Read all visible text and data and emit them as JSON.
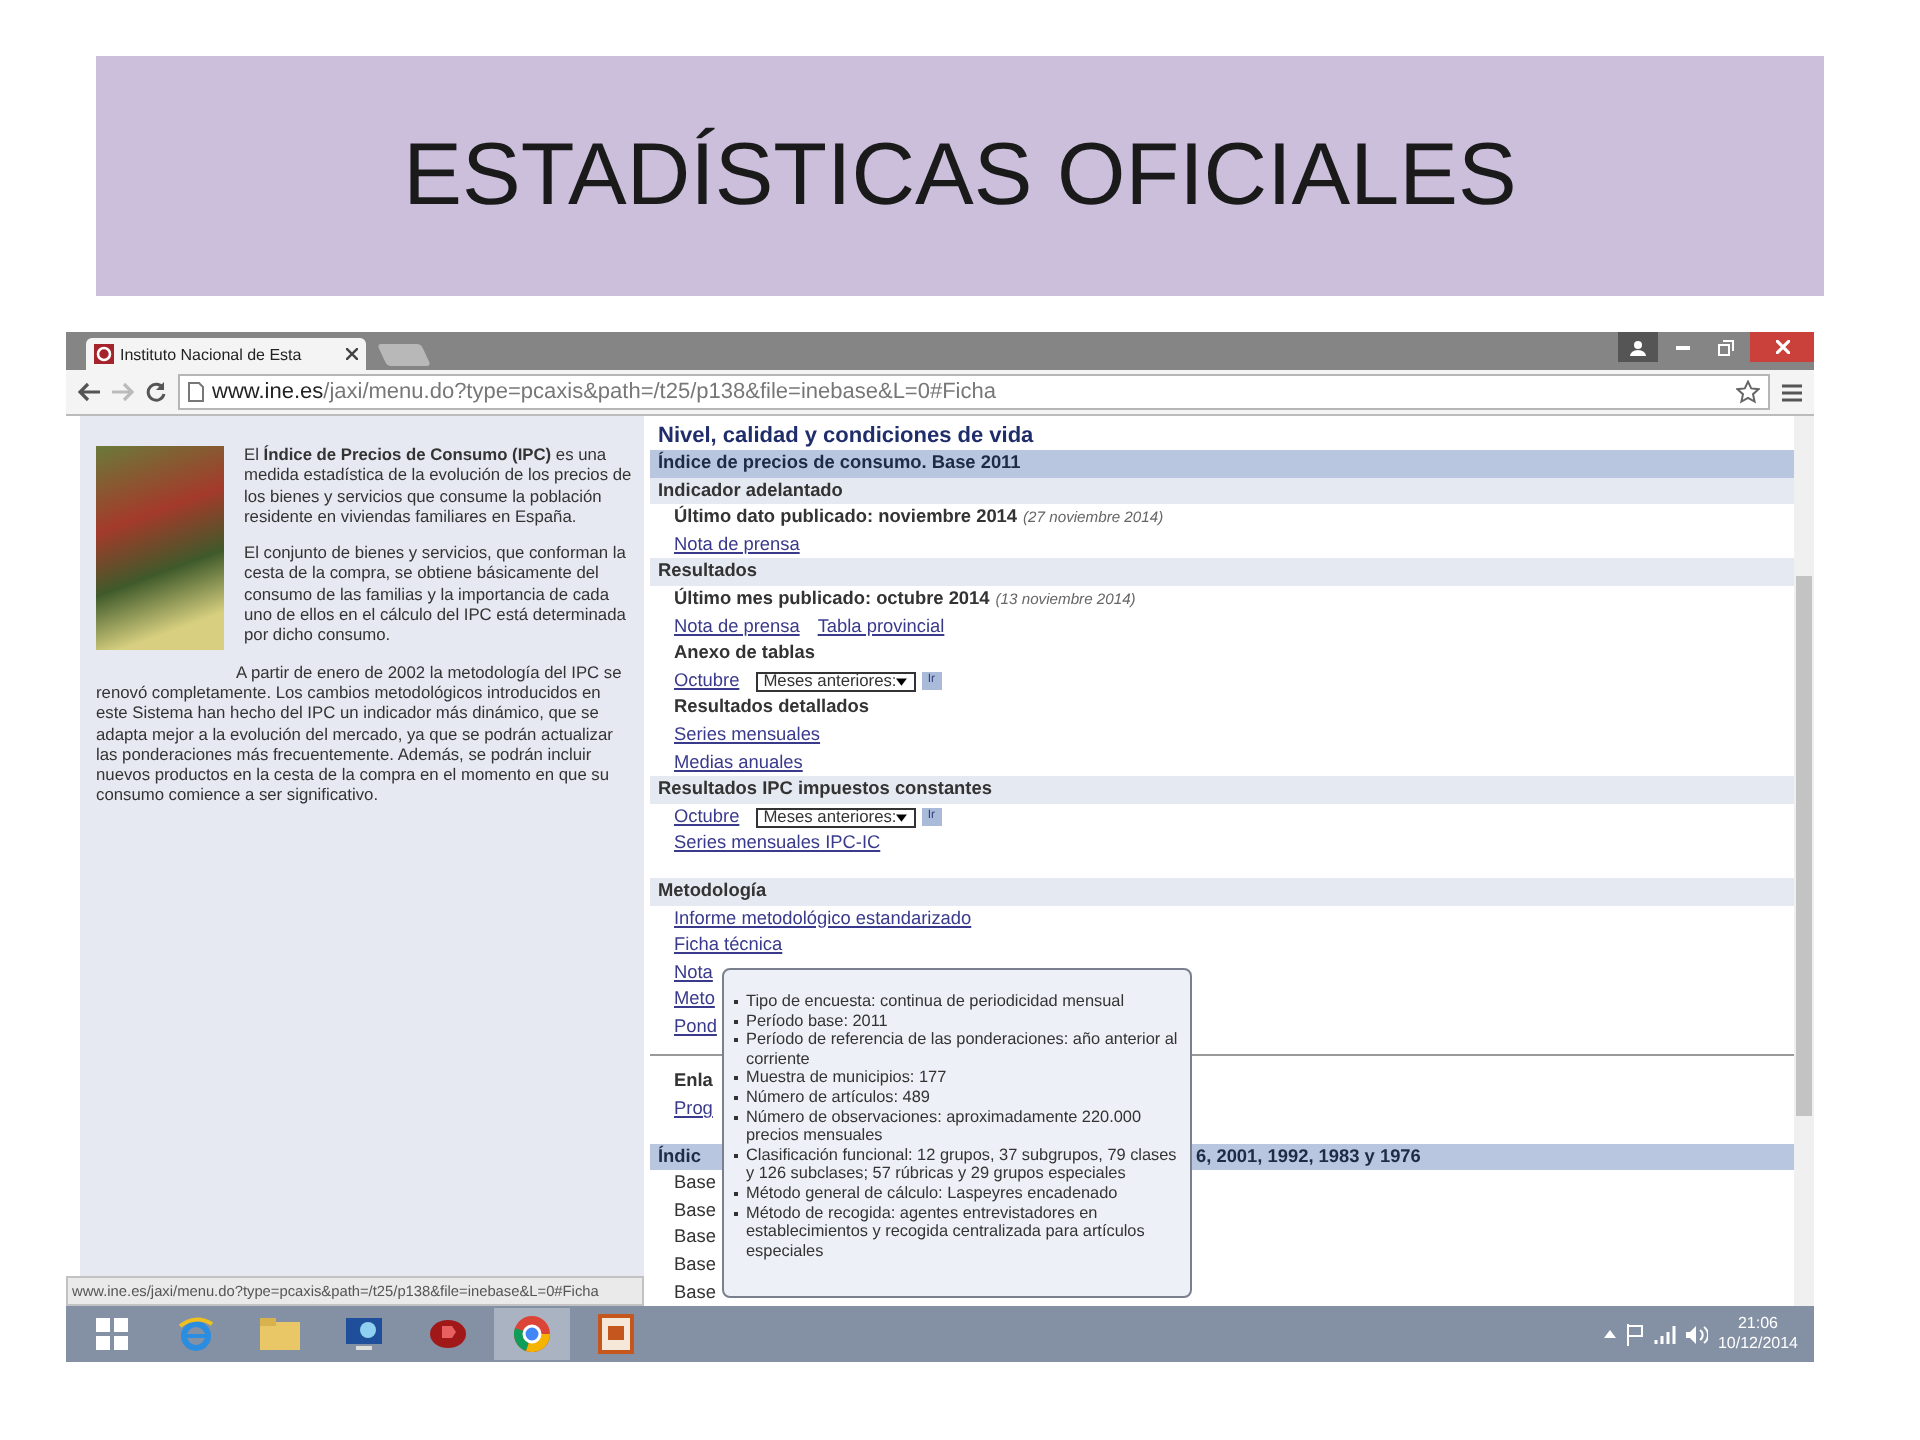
{
  "slide": {
    "title": "ESTADÍSTICAS OFICIALES"
  },
  "browser": {
    "tab": {
      "title": "Instituto Nacional de Esta",
      "selected": true
    },
    "address": {
      "domain": "www.ine.es",
      "path": "/jaxi/menu.do?type=pcaxis&path=/t25/p138&file=inebase&L=0#Ficha"
    },
    "status_url": "www.ine.es/jaxi/menu.do?type=pcaxis&path=/t25/p138&file=inebase&L=0#Ficha"
  },
  "intro": {
    "paragraphs": [
      "El **Índice de Precios de Consumo (IPC)** es una medida estadística de la evolución de los precios de los bienes y servicios que consume la población residente en viviendas familiares en España.",
      "El conjunto de bienes y servicios, que conforman la cesta de la compra, se obtiene básicamente del consumo de las familias y la importancia de cada uno de ellos en el cálculo del IPC está determinada por dicho consumo.",
      "A partir de enero de 2002 la metodología del IPC se renovó completamente. Los cambios metodológicos introducidos en este Sistema han hecho del IPC un indicador más dinámico, que se adapta mejor a la evolución del mercado, ya que se podrán actualizar las ponderaciones más frecuentemente. Además, se podrán incluir nuevos productos en la cesta de la compra en el momento en que su consumo comience a ser significativo."
    ]
  },
  "content": {
    "title": "Nivel, calidad y condiciones de vida",
    "rows": [
      {
        "kind": "header",
        "text": "Índice de precios de consumo. Base 2011"
      },
      {
        "kind": "section",
        "text": "Indicador adelantado"
      },
      {
        "kind": "info",
        "text": "Último dato publicado: noviembre 2014",
        "date": "(27 noviembre 2014)"
      },
      {
        "kind": "links",
        "links": [
          "Nota de prensa"
        ]
      },
      {
        "kind": "section",
        "text": "Resultados"
      },
      {
        "kind": "info",
        "text": "Último mes publicado: octubre 2014",
        "date": "(13 noviembre 2014)"
      },
      {
        "kind": "links",
        "links": [
          "Nota de prensa",
          "Tabla provincial"
        ]
      },
      {
        "kind": "subhead",
        "text": "Anexo de tablas"
      },
      {
        "kind": "select",
        "link": "Octubre",
        "select": "Meses anteriores:",
        "button": "Ir"
      },
      {
        "kind": "subhead",
        "text": "Resultados detallados"
      },
      {
        "kind": "links",
        "links": [
          "Series mensuales"
        ]
      },
      {
        "kind": "links",
        "links": [
          "Medias anuales"
        ]
      },
      {
        "kind": "section",
        "text": "Resultados IPC impuestos constantes"
      },
      {
        "kind": "select",
        "link": "Octubre",
        "select": "Meses anteriores:",
        "button": "Ir"
      },
      {
        "kind": "links",
        "links": [
          "Series mensuales IPC-IC"
        ]
      },
      {
        "kind": "spacer"
      },
      {
        "kind": "section",
        "text": "Metodología"
      },
      {
        "kind": "links",
        "links": [
          "Informe metodológico estandarizado"
        ]
      },
      {
        "kind": "links",
        "links": [
          "Ficha técnica"
        ]
      },
      {
        "kind": "links",
        "links": [
          "Nota"
        ]
      },
      {
        "kind": "links",
        "links": [
          "Meto"
        ]
      },
      {
        "kind": "links",
        "links": [
          "Pond"
        ]
      },
      {
        "kind": "rule"
      },
      {
        "kind": "subhead",
        "text": "Enla"
      },
      {
        "kind": "links",
        "links": [
          "Prog"
        ]
      },
      {
        "kind": "spacer"
      },
      {
        "kind": "split-header",
        "left": "Índic",
        "right": "6, 2001, 1992, 1983 y 1976"
      },
      {
        "kind": "plain",
        "text": "Base"
      },
      {
        "kind": "plain",
        "text": "Base"
      },
      {
        "kind": "plain",
        "text": "Base"
      },
      {
        "kind": "plain",
        "text": "Base"
      },
      {
        "kind": "plain",
        "text": "Base"
      }
    ]
  },
  "tooltip": {
    "items": [
      "Tipo de encuesta: continua de periodicidad mensual",
      "Período base: 2011",
      "Período de referencia de las ponderaciones: año anterior al corriente",
      "Muestra de municipios: 177",
      "Número de artículos: 489",
      "Número de observaciones: aproximadamente 220.000 precios mensuales",
      "Clasificación funcional: 12 grupos, 37 subgrupos, 79 clases y 126 subclases; 57 rúbricas y 29 grupos especiales",
      "Método general de cálculo: Laspeyres encadenado",
      "Método de recogida: agentes entrevistadores en establecimientos y recogida centralizada para artículos especiales"
    ]
  },
  "taskbar": {
    "apps": [
      {
        "kind": "ie",
        "selected": false
      },
      {
        "kind": "folder",
        "selected": false
      },
      {
        "kind": "network",
        "selected": false
      },
      {
        "kind": "red",
        "selected": false
      },
      {
        "kind": "chrome",
        "selected": true
      },
      {
        "kind": "slides",
        "selected": false
      }
    ],
    "time": "21:06",
    "date": "10/12/2014"
  }
}
